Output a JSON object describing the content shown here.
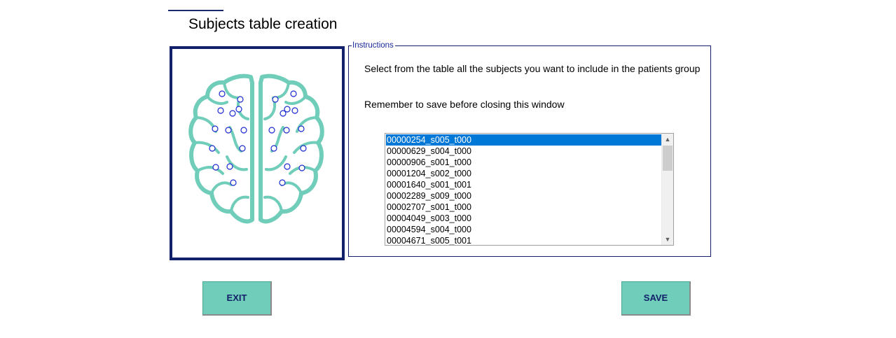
{
  "header": {
    "title": "Subjects table creation"
  },
  "instructions": {
    "legend": "Instructions",
    "line1": "Select from the table all the subjects you want to include in the patients group",
    "line2": "Remember to save before closing this window"
  },
  "subjects_list": {
    "items": [
      "00000254_s005_t000",
      "00000629_s004_t000",
      "00000906_s001_t000",
      "00001204_s002_t000",
      "00001640_s001_t001",
      "00002289_s009_t000",
      "00002707_s001_t000",
      "00004049_s003_t000",
      "00004594_s004_t000",
      "00004671_s005_t001"
    ],
    "selected_index": 0
  },
  "buttons": {
    "exit_label": "EXIT",
    "save_label": "SAVE"
  },
  "illustration": {
    "icon": "brain-eeg-electrodes-icon",
    "brain_color": "#6fcdb9",
    "electrode_color": "#1a2ad0"
  },
  "colors": {
    "accent": "#6fcdb9",
    "navy": "#13216a",
    "selection": "#0078d7"
  }
}
